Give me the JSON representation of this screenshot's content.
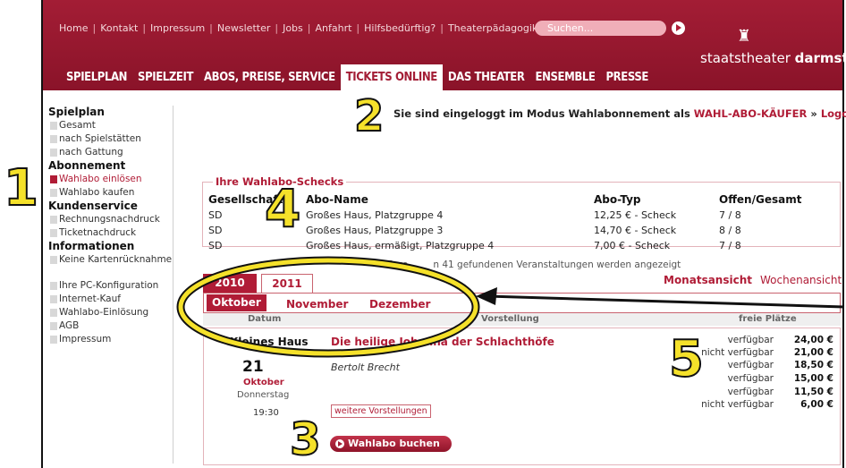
{
  "header": {
    "topnav": [
      "Home",
      "Kontakt",
      "Impressum",
      "Newsletter",
      "Jobs",
      "Anfahrt",
      "Hilfsbedürftig?",
      "Theaterpädagogik"
    ],
    "search_placeholder": "Suchen...",
    "logo_prefix": "staatstheater ",
    "logo_bold": "darmstadt",
    "mainnav": [
      "SPIELPLAN",
      "SPIELZEIT",
      "ABOS, PREISE, SERVICE",
      "TICKETS ONLINE",
      "DAS THEATER",
      "ENSEMBLE",
      "PRESSE"
    ],
    "active_index": 3
  },
  "sidebar": {
    "sections": [
      {
        "heading": "Spielplan",
        "items": [
          "Gesamt",
          "nach Spielstätten",
          "nach Gattung"
        ]
      },
      {
        "heading": "Abonnement",
        "items": [
          "Wahlabo einlösen",
          "Wahlabo kaufen"
        ]
      },
      {
        "heading": "Kundenservice",
        "items": [
          "Rechnungsnachdruck",
          "Ticketnachdruck"
        ]
      },
      {
        "heading": "Informationen",
        "items": [
          "Keine Kartenrücknahme",
          "Ihre PC-Konfiguration",
          "Internet-Kauf",
          "Wahlabo-Einlösung",
          "AGB",
          "Impressum"
        ]
      }
    ],
    "active_item": "Wahlabo einlösen"
  },
  "login": {
    "prefix": "Sie sind eingeloggt im Modus Wahlabonnement als ",
    "role": "WAHL-ABO-KÄUFER",
    "separator": " » ",
    "logout": "Logout"
  },
  "schecks": {
    "title": "Ihre Wahlabo-Schecks",
    "columns": [
      "Gesellschaft",
      "Abo-Name",
      "Abo-Typ",
      "Offen/Gesamt"
    ],
    "rows": [
      [
        "SD",
        "Großes Haus, Platzgruppe 4",
        "12,25 € - Scheck",
        "7 / 8"
      ],
      [
        "SD",
        "Großes Haus, Platzgruppe 3",
        "14,70 € - Scheck",
        "8 / 8"
      ],
      [
        "SD",
        "Großes Haus, ermäßigt, Platzgruppe 4",
        "7,00 € - Scheck",
        "7 / 8"
      ]
    ]
  },
  "listing": {
    "found_left": "28 vo",
    "found_right": "n 41 gefundenen Veranstaltungen werden angezeigt",
    "years": [
      "2010",
      "2011"
    ],
    "months": [
      "Oktober",
      "November",
      "Dezember"
    ],
    "view_month": "Monatsansicht",
    "view_week": "Wochenansicht",
    "col_date": "Datum",
    "col_show": "Vorstellung",
    "col_seats": "freie Plätze"
  },
  "event": {
    "venue": "Kleines Haus",
    "day": "21",
    "month": "Oktober",
    "weekday": "Donnerstag",
    "time": "19:30",
    "title": "Die heilige Johanna der Schlachthöfe",
    "author": "Bertolt Brecht",
    "more_label": "weitere Vorstellungen",
    "book_label": "Wahlabo buchen",
    "prices": [
      {
        "status": "verfügbar",
        "price": "24,00 €"
      },
      {
        "status": "nicht verfügbar",
        "price": "21,00 €"
      },
      {
        "status": "verfügbar",
        "price": "18,50 €"
      },
      {
        "status": "verfügbar",
        "price": "15,00 €"
      },
      {
        "status": "verfügbar",
        "price": "11,50 €"
      },
      {
        "status": "nicht verfügbar",
        "price": "6,00 €"
      }
    ]
  },
  "annotations": {
    "markers": [
      "1",
      "2",
      "3",
      "4",
      "5"
    ],
    "highlight_color": "#f5e12a"
  }
}
